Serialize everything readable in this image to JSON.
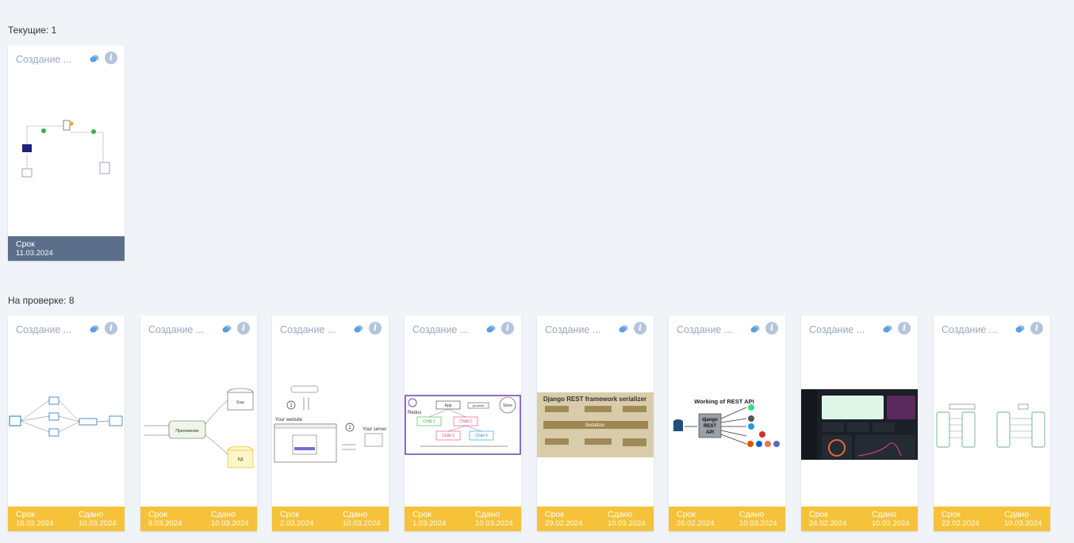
{
  "current": {
    "heading": "Текущие: 1",
    "cards": [
      {
        "title": "Создание ...",
        "deadline_label": "Срок",
        "deadline": "11.03.2024",
        "thumb_icon": "diagram-thumbnail-auth-flow"
      }
    ]
  },
  "review": {
    "heading": "На проверке: 8",
    "cards": [
      {
        "title": "Создание ...",
        "deadline_label": "Срок",
        "deadline": "16.03.2024",
        "submitted_label": "Сдано",
        "submitted": "10.03.2024",
        "thumb_icon": "diagram-thumbnail-network"
      },
      {
        "title": "Создание ...",
        "deadline_label": "Срок",
        "deadline": "8.03.2024",
        "submitted_label": "Сдано",
        "submitted": "10.03.2024",
        "thumb_icon": "diagram-thumbnail-cache-flow"
      },
      {
        "title": "Создание ...",
        "deadline_label": "Срок",
        "deadline": "2.03.2024",
        "submitted_label": "Сдано",
        "submitted": "10.03.2024",
        "thumb_icon": "diagram-thumbnail-website-server"
      },
      {
        "title": "Создание ...",
        "deadline_label": "Срок",
        "deadline": "1.03.2024",
        "submitted_label": "Сдано",
        "submitted": "10.03.2024",
        "thumb_icon": "diagram-thumbnail-redux"
      },
      {
        "title": "Создание ...",
        "deadline_label": "Срок",
        "deadline": "29.02.2024",
        "submitted_label": "Сдано",
        "submitted": "10.03.2024",
        "thumb_icon": "diagram-thumbnail-django-serializer"
      },
      {
        "title": "Создание ...",
        "deadline_label": "Срок",
        "deadline": "26.02.2024",
        "submitted_label": "Сдано",
        "submitted": "10.03.2024",
        "thumb_icon": "diagram-thumbnail-rest-api"
      },
      {
        "title": "Создание ...",
        "deadline_label": "Срок",
        "deadline": "24.02.2024",
        "submitted_label": "Сдано",
        "submitted": "10.03.2024",
        "thumb_icon": "screenshot-thumbnail-dark-dashboard"
      },
      {
        "title": "Создание ...",
        "deadline_label": "Срок",
        "deadline": "22.02.2024",
        "submitted_label": "Сдано",
        "submitted": "10.03.2024",
        "thumb_icon": "diagram-thumbnail-sequence"
      }
    ]
  },
  "thumb_text": {
    "django_title": "Django REST framework serializer",
    "django_serializer": "Serializer",
    "rest_title": "Working of REST API",
    "rest_box": [
      "django",
      "REST",
      "API"
    ],
    "redux_label": "Redux",
    "redux_nodes": [
      "App",
      "provider",
      "Store",
      "Child 1",
      "Child 2",
      "Child 3",
      "Child 4"
    ],
    "website_label": "Your website",
    "server_label": "Your server",
    "cache_center": "Приложение",
    "cache_db": "Кэш",
    "sql_db": "БД"
  },
  "colors": {
    "background": "#f0f4f8",
    "card_title": "#9aa8bb",
    "footer_current": "#5b6f8b",
    "footer_review": "#f5c23a",
    "chat_icon": "#8ab8e6",
    "info_icon": "#b3c5da"
  }
}
